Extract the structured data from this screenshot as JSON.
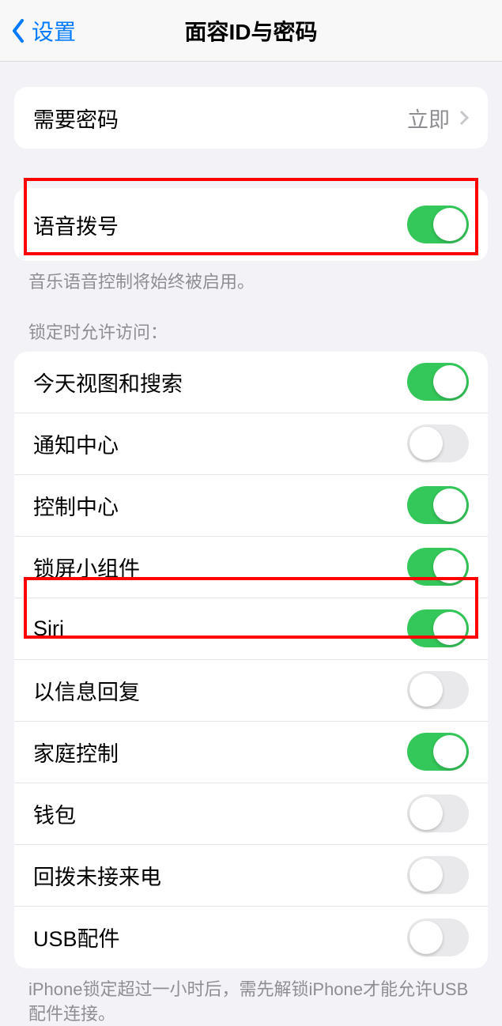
{
  "header": {
    "back_label": "设置",
    "title": "面容ID与密码"
  },
  "passcode_group": {
    "require_passcode": {
      "label": "需要密码",
      "value": "立即"
    }
  },
  "voice_group": {
    "voice_dial": {
      "label": "语音拨号",
      "on": true
    },
    "footer": "音乐语音控制将始终被启用。"
  },
  "locked_section": {
    "header": "锁定时允许访问：",
    "items": [
      {
        "label": "今天视图和搜索",
        "on": true
      },
      {
        "label": "通知中心",
        "on": false
      },
      {
        "label": "控制中心",
        "on": true
      },
      {
        "label": "锁屏小组件",
        "on": true
      },
      {
        "label": "Siri",
        "on": true
      },
      {
        "label": "以信息回复",
        "on": false
      },
      {
        "label": "家庭控制",
        "on": true
      },
      {
        "label": "钱包",
        "on": false
      },
      {
        "label": "回拨未接来电",
        "on": false
      },
      {
        "label": "USB配件",
        "on": false
      }
    ],
    "footer": "iPhone锁定超过一小时后，需先解锁iPhone才能允许USB配件连接。"
  }
}
